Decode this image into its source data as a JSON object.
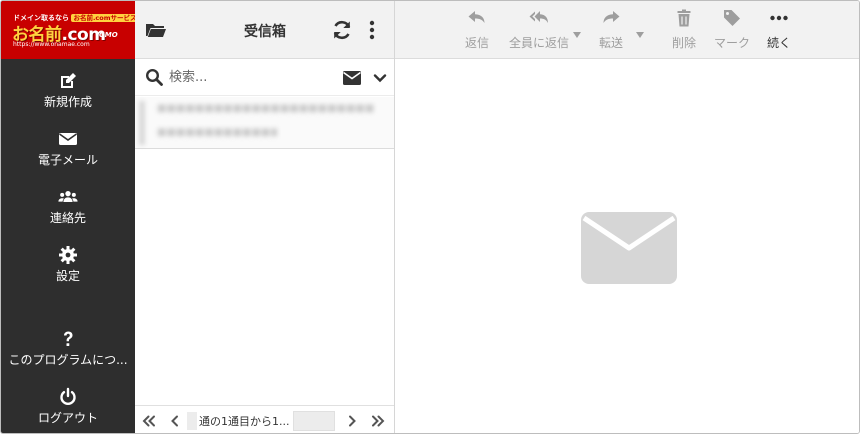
{
  "brand": {
    "tagline": "ドメイン取るなら",
    "badge": "お名前.comサービス",
    "name_prefix": "お名前",
    "name_suffix": ".com",
    "url": "https://www.onamae.com",
    "gmo": "GMO"
  },
  "sidebar": {
    "items": [
      {
        "label": "新規作成",
        "icon": "compose-icon"
      },
      {
        "label": "電子メール",
        "icon": "envelope-icon"
      },
      {
        "label": "連絡先",
        "icon": "contacts-icon"
      },
      {
        "label": "設定",
        "icon": "gear-icon"
      },
      {
        "label": "このプログラムにつ...",
        "icon": "question-icon"
      },
      {
        "label": "ログアウト",
        "icon": "power-icon"
      }
    ]
  },
  "mailbox": {
    "title": "受信箱",
    "search_placeholder": "検索...",
    "pager_text": "通の1通目から1..."
  },
  "toolbar": {
    "reply": "返信",
    "reply_all": "全員に返信",
    "forward": "転送",
    "delete": "削除",
    "mark": "マーク",
    "more": "続く"
  },
  "colors": {
    "brand_red": "#c80000",
    "sidebar_bg": "#2e2e2e",
    "toolbar_bg": "#f2f2f2",
    "icon_dark": "#333333",
    "icon_disabled": "#9e9e9e"
  }
}
